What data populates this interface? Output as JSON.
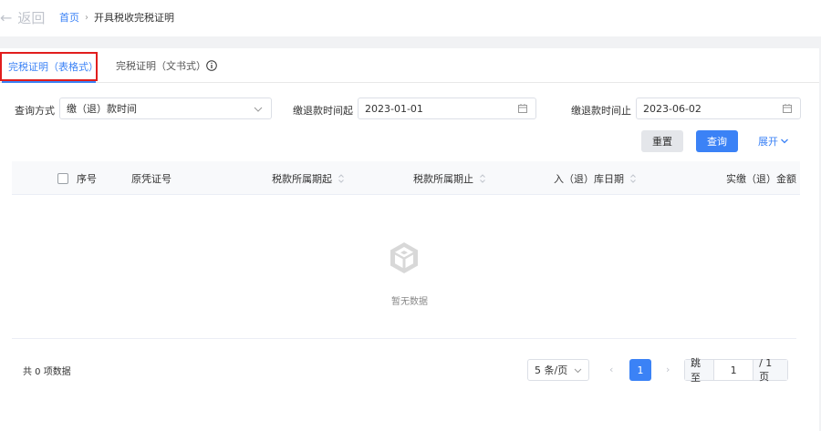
{
  "header": {
    "back_label": "返回",
    "breadcrumb_home": "首页",
    "breadcrumb_current": "开具税收完税证明"
  },
  "tabs": [
    {
      "label": "完税证明（表格式）",
      "active": true
    },
    {
      "label": "完税证明（文书式）",
      "active": false
    }
  ],
  "filters": {
    "query_method_label": "查询方式",
    "query_method_value": "缴（退）款时间",
    "start_label": "缴退款时间起",
    "start_value": "2023-01-01",
    "end_label": "缴退款时间止",
    "end_value": "2023-06-02"
  },
  "buttons": {
    "reset": "重置",
    "query": "查询",
    "expand": "展开"
  },
  "table": {
    "columns": [
      "序号",
      "原凭证号",
      "税款所属期起",
      "税款所属期止",
      "入（退）库日期",
      "实缴（退）金额"
    ],
    "rows": [],
    "empty_text": "暂无数据"
  },
  "pagination": {
    "total_text": "共 0 项数据",
    "page_size": "5 条/页",
    "current_page": "1",
    "jump_label": "跳至",
    "jump_value": "1",
    "total_pages": "/ 1 页"
  },
  "colors": {
    "accent": "#3b82f6",
    "highlight_border": "#e11d1d"
  }
}
